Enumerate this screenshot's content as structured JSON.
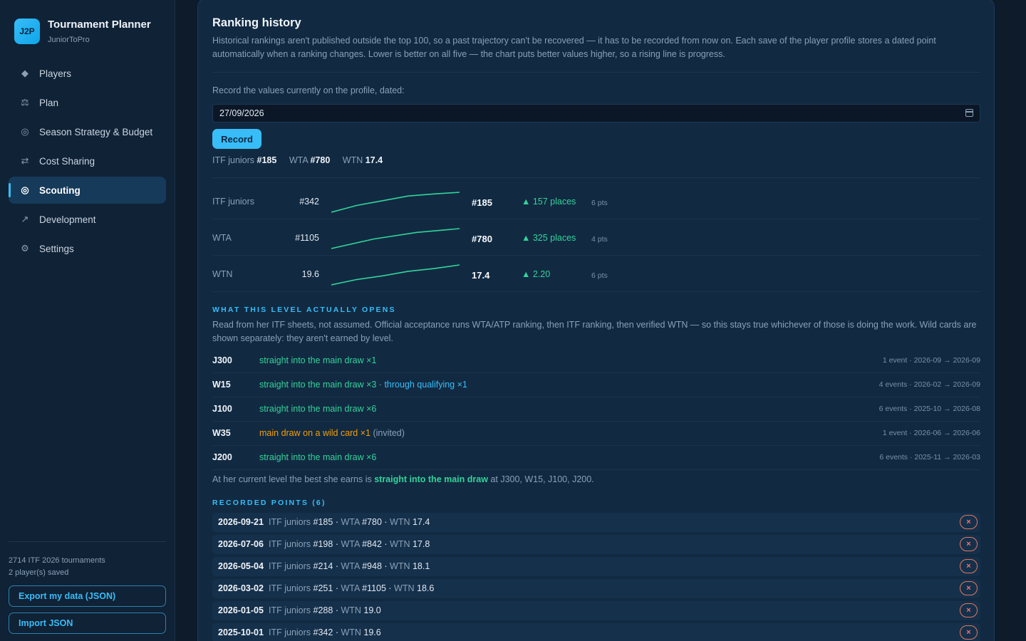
{
  "brand": {
    "logo": "J2P",
    "title": "Tournament Planner",
    "subtitle": "JuniorToPro"
  },
  "nav": [
    {
      "label": "Players",
      "icon": "diamond-icon",
      "glyph": "◆"
    },
    {
      "label": "Plan",
      "icon": "scales-icon",
      "glyph": "⚖"
    },
    {
      "label": "Season Strategy & Budget",
      "icon": "target-icon",
      "glyph": "◎"
    },
    {
      "label": "Cost Sharing",
      "icon": "swap-arrows-icon",
      "glyph": "⇄"
    },
    {
      "label": "Scouting",
      "icon": "radar-icon",
      "glyph": "◎",
      "active": true
    },
    {
      "label": "Development",
      "icon": "trend-arrow-icon",
      "glyph": "↗"
    },
    {
      "label": "Settings",
      "icon": "gear-icon",
      "glyph": "⚙"
    }
  ],
  "sidebar_footer": {
    "stats": [
      "2714 ITF 2026 tournaments",
      "2 player(s) saved"
    ],
    "export_label": "Export my data (JSON)",
    "import_label": "Import JSON"
  },
  "ranking": {
    "title": "Ranking history",
    "description": "Historical rankings aren't published outside the top 100, so a past trajectory can't be recovered — it has to be recorded from now on. Each save of the player profile stores a dated point automatically when a ranking changes. Lower is better on all five — the chart puts better values higher, so a rising line is progress.",
    "record_label": "Record the values currently on the profile, dated:",
    "date_value": "27/09/2026",
    "record_button": "Record",
    "current": {
      "itf_label": "ITF juniors",
      "itf": "#185",
      "wta_label": "WTA",
      "wta": "#780",
      "wtn_label": "WTN",
      "wtn": "17.4"
    },
    "rows": [
      {
        "label": "ITF juniors",
        "from": "#342",
        "to": "#185",
        "change": "▲ 157 places",
        "points": "6 pts",
        "trend": [
          342,
          288,
          251,
          214,
          198,
          185
        ]
      },
      {
        "label": "WTA",
        "from": "#1105",
        "to": "#780",
        "change": "▲ 325 places",
        "points": "4 pts",
        "trend": [
          1105,
          948,
          842,
          780
        ]
      },
      {
        "label": "WTN",
        "from": "19.6",
        "to": "17.4",
        "change": "▲ 2.20",
        "points": "6 pts",
        "trend": [
          19.6,
          19.0,
          18.6,
          18.1,
          17.8,
          17.4
        ]
      }
    ]
  },
  "levels": {
    "heading": "WHAT THIS LEVEL ACTUALLY OPENS",
    "description": "Read from her ITF sheets, not assumed. Official acceptance runs WTA/ATP ranking, then ITF ranking, then verified WTN — so this stays true whichever of those is doing the work. Wild cards are shown separately: they aren't earned by level.",
    "rows": [
      {
        "code": "J300",
        "main": "straight into the main draw ×1",
        "qual": "",
        "wild": "",
        "invited": "",
        "meta": "1 event · 2026-09 → 2026-09"
      },
      {
        "code": "W15",
        "main": "straight into the main draw ×3",
        "sep": " · ",
        "qual": "through qualifying ×1",
        "wild": "",
        "invited": "",
        "meta": "4 events · 2026-02 → 2026-09"
      },
      {
        "code": "J100",
        "main": "straight into the main draw ×6",
        "qual": "",
        "wild": "",
        "invited": "",
        "meta": "6 events · 2025-10 → 2026-08"
      },
      {
        "code": "W35",
        "main": "",
        "qual": "",
        "wild": "main draw on a wild card ×1",
        "invited": " (invited)",
        "meta": "1 event · 2026-06 → 2026-06"
      },
      {
        "code": "J200",
        "main": "straight into the main draw ×6",
        "qual": "",
        "wild": "",
        "invited": "",
        "meta": "6 events · 2025-11 → 2026-03"
      }
    ],
    "summary_prefix": "At her current level the best she earns is ",
    "summary_strong": "straight into the main draw",
    "summary_suffix": " at J300, W15, J100, J200."
  },
  "points": {
    "heading": "RECORDED POINTS (6)",
    "rows": [
      {
        "date": "2026-09-21",
        "parts": [
          [
            "ITF juniors",
            "#185"
          ],
          [
            "WTA",
            "#780"
          ],
          [
            "WTN",
            "17.4"
          ]
        ]
      },
      {
        "date": "2026-07-06",
        "parts": [
          [
            "ITF juniors",
            "#198"
          ],
          [
            "WTA",
            "#842"
          ],
          [
            "WTN",
            "17.8"
          ]
        ]
      },
      {
        "date": "2026-05-04",
        "parts": [
          [
            "ITF juniors",
            "#214"
          ],
          [
            "WTA",
            "#948"
          ],
          [
            "WTN",
            "18.1"
          ]
        ]
      },
      {
        "date": "2026-03-02",
        "parts": [
          [
            "ITF juniors",
            "#251"
          ],
          [
            "WTA",
            "#1105"
          ],
          [
            "WTN",
            "18.6"
          ]
        ]
      },
      {
        "date": "2026-01-05",
        "parts": [
          [
            "ITF juniors",
            "#288"
          ],
          [
            "WTN",
            "19.0"
          ]
        ]
      },
      {
        "date": "2025-10-01",
        "parts": [
          [
            "ITF juniors",
            "#342"
          ],
          [
            "WTN",
            "19.6"
          ]
        ]
      }
    ],
    "delete_glyph": "×"
  },
  "colors": {
    "accent": "#38bdf8",
    "positive": "#34d399",
    "warning": "#f59e0b",
    "danger": "#f87171"
  }
}
